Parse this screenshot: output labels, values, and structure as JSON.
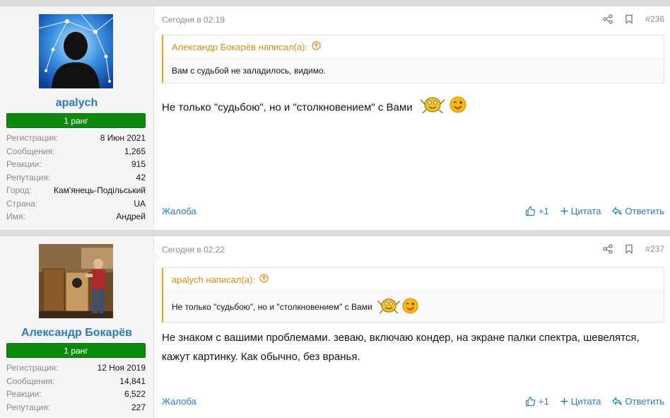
{
  "posts": [
    {
      "user": {
        "name": "apalych",
        "rank": "1 ранг",
        "stats": [
          {
            "k": "Регистрация:",
            "v": "8 Июн 2021"
          },
          {
            "k": "Сообщения:",
            "v": "1,265"
          },
          {
            "k": "Реакции:",
            "v": "915"
          },
          {
            "k": "Репутация:",
            "v": "42"
          },
          {
            "k": "Город:",
            "v": "Кам'янець-Подільський"
          },
          {
            "k": "Страна:",
            "v": "UA"
          },
          {
            "k": "Имя:",
            "v": "Андрей"
          }
        ]
      },
      "date": "Сегодня в 02:19",
      "num": "#236",
      "quote_author": "Александр Бокарёв написал(а):",
      "quote_text": "Вам с судьбой не заладилось, видимо.",
      "message": "Не только \"судьбою\", но и \"столкновением\" с Вами",
      "report": "Жалоба",
      "like_count": "+1",
      "quote_label": "Цитата",
      "reply_label": "Ответить"
    },
    {
      "user": {
        "name": "Александр Бокарёв",
        "rank": "1 ранг",
        "stats": [
          {
            "k": "Регистрация:",
            "v": "12 Ноя 2019"
          },
          {
            "k": "Сообщения:",
            "v": "14,841"
          },
          {
            "k": "Реакции:",
            "v": "6,522"
          },
          {
            "k": "Репутация:",
            "v": "227"
          }
        ]
      },
      "date": "Сегодня в 02:22",
      "num": "#237",
      "quote_author": "apalych написал(а):",
      "quote_text": "Не только \"судьбою\", но и \"столкновением\" с Вами",
      "message": "Не знаком с вашими проблемами. зеваю, включаю кондер, на экране палки спектра, шевелятся, кажут картинку. Как обычно, без вранья.",
      "report": "Жалоба",
      "like_count": "+1",
      "quote_label": "Цитата",
      "reply_label": "Ответить"
    }
  ],
  "colors": {
    "link": "#2a7bbf",
    "rank_bg": "#0c8a0c",
    "quote_accent": "#f0a020"
  }
}
